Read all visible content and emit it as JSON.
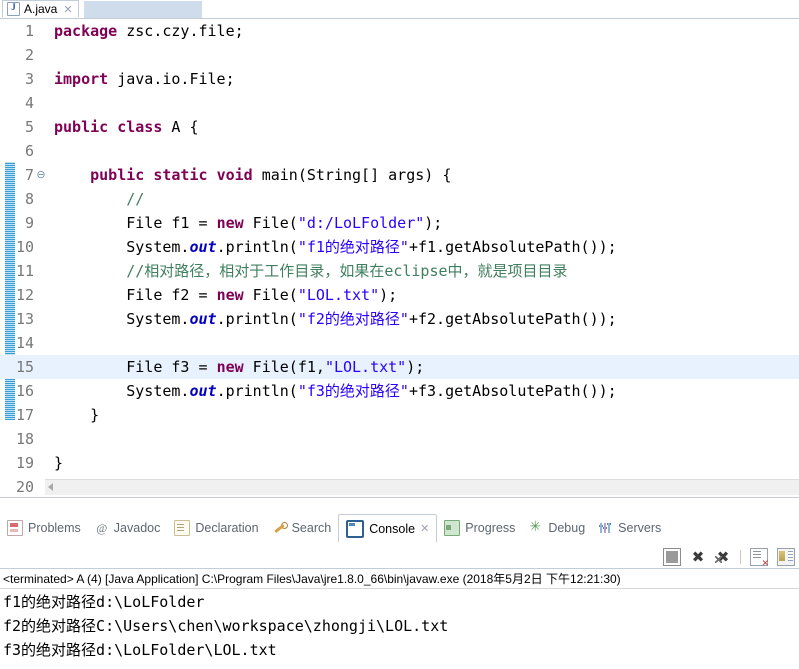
{
  "editor": {
    "tab": {
      "icon": "java-file-icon",
      "title": "A.java",
      "close": "✕"
    },
    "lines": [
      {
        "n": "1",
        "fold": "",
        "html": "<span class='kw'>package</span> zsc.czy.file;"
      },
      {
        "n": "2",
        "fold": "",
        "html": ""
      },
      {
        "n": "3",
        "fold": "",
        "html": "<span class='kw'>import</span> java.io.File;"
      },
      {
        "n": "4",
        "fold": "",
        "html": ""
      },
      {
        "n": "5",
        "fold": "",
        "html": "<span class='kw'>public</span> <span class='kw'>class</span> A {"
      },
      {
        "n": "6",
        "fold": "",
        "html": ""
      },
      {
        "n": "7",
        "fold": "⊖",
        "html": "    <span class='kw'>public</span> <span class='kw'>static</span> <span class='kw'>void</span> main(String[] args) {"
      },
      {
        "n": "8",
        "fold": "",
        "html": "        <span class='cmt'>//</span>"
      },
      {
        "n": "9",
        "fold": "",
        "html": "        File f1 = <span class='kw'>new</span> File(<span class='str'>\"d:/LoLFolder\"</span>);"
      },
      {
        "n": "10",
        "fold": "",
        "html": "        System.<span class='fld'>out</span>.println(<span class='str'>\"f1的绝对路径\"</span>+f1.getAbsolutePath());"
      },
      {
        "n": "11",
        "fold": "",
        "html": "        <span class='cmt'>//相对路径，相对于工作目录，如果在eclipse中，就是项目目录</span>"
      },
      {
        "n": "12",
        "fold": "",
        "html": "        File f2 = <span class='kw'>new</span> File(<span class='str'>\"LOL.txt\"</span>);"
      },
      {
        "n": "13",
        "fold": "",
        "html": "        System.<span class='fld'>out</span>.println(<span class='str'>\"f2的绝对路径\"</span>+f2.getAbsolutePath());"
      },
      {
        "n": "14",
        "fold": "",
        "html": ""
      },
      {
        "n": "15",
        "fold": "",
        "html": "        File f3 = <span class='kw'>new</span> File(f1,<span class='str'>\"LOL.txt\"</span>);",
        "current": true
      },
      {
        "n": "16",
        "fold": "",
        "html": "        System.<span class='fld'>out</span>.println(<span class='str'>\"f3的绝对路径\"</span>+f3.getAbsolutePath());"
      },
      {
        "n": "17",
        "fold": "",
        "html": "    }"
      },
      {
        "n": "18",
        "fold": "",
        "html": ""
      },
      {
        "n": "19",
        "fold": "",
        "html": "}"
      },
      {
        "n": "20",
        "fold": "",
        "html": ""
      }
    ]
  },
  "panel": {
    "tabs": [
      {
        "label": "Problems",
        "icon": "problems-icon",
        "active": false
      },
      {
        "label": "Javadoc",
        "icon": "javadoc-icon",
        "active": false
      },
      {
        "label": "Declaration",
        "icon": "declaration-icon",
        "active": false
      },
      {
        "label": "Search",
        "icon": "search-icon",
        "active": false
      },
      {
        "label": "Console",
        "icon": "console-icon",
        "active": true,
        "close": "✕"
      },
      {
        "label": "Progress",
        "icon": "progress-icon",
        "active": false
      },
      {
        "label": "Debug",
        "icon": "debug-icon",
        "active": false
      },
      {
        "label": "Servers",
        "icon": "servers-icon",
        "active": false
      }
    ],
    "toolbar": [
      {
        "name": "terminate-button"
      },
      {
        "name": "remove-launch-button",
        "glyph": "✖"
      },
      {
        "name": "remove-all-terminated-button",
        "glyph": "✖"
      },
      {
        "name": "toolbar-separator"
      },
      {
        "name": "clear-console-button"
      },
      {
        "name": "scroll-lock-button"
      }
    ],
    "console": {
      "header": "<terminated> A (4) [Java Application] C:\\Program Files\\Java\\jre1.8.0_66\\bin\\javaw.exe (2018年5月2日 下午12:21:30)",
      "output": [
        "f1的绝对路径d:\\LoLFolder",
        "f2的绝对路径C:\\Users\\chen\\workspace\\zhongji\\LOL.txt",
        "f3的绝对路径d:\\LoLFolder\\LOL.txt"
      ]
    }
  },
  "colors": {
    "keyword": "#7F0055",
    "string": "#2A00FF",
    "comment": "#3F7F5F",
    "field": "#0000C0",
    "current_line": "#E8F2FE",
    "tab_active": "#CFDCEC",
    "border": "#C3CCD9"
  }
}
